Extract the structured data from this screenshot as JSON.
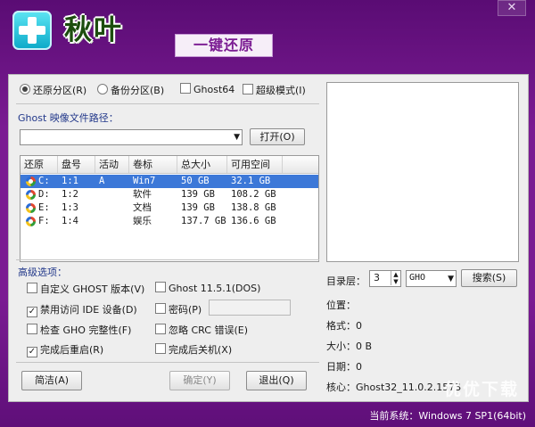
{
  "header": {
    "app_title": "秋叶",
    "tagline": "一键还原",
    "close_glyph": "✕"
  },
  "mode": {
    "restore_label": "还原分区(R)",
    "backup_label": "备份分区(B)",
    "ghost64_label": "Ghost64",
    "super_mode_label": "超级模式(I)",
    "selected": "restore"
  },
  "ghost_path": {
    "label": "Ghost 映像文件路径：",
    "value": "",
    "open_button": "打开(O)"
  },
  "table": {
    "columns": [
      "还原",
      "盘号",
      "活动",
      "卷标",
      "总大小",
      "可用空间"
    ],
    "rows": [
      {
        "drive": "C:",
        "num": "1:1",
        "active": "A",
        "label": "Win7",
        "total": "50 GB",
        "free": "32.1 GB",
        "selected": true
      },
      {
        "drive": "D:",
        "num": "1:2",
        "active": "",
        "label": "软件",
        "total": "139 GB",
        "free": "108.2 GB",
        "selected": false
      },
      {
        "drive": "E:",
        "num": "1:3",
        "active": "",
        "label": "文档",
        "total": "139 GB",
        "free": "138.8 GB",
        "selected": false
      },
      {
        "drive": "F:",
        "num": "1:4",
        "active": "",
        "label": "娱乐",
        "total": "137.7 GB",
        "free": "136.6 GB",
        "selected": false
      }
    ]
  },
  "advanced": {
    "title": "高级选项：",
    "custom_ghost": {
      "label": "自定义 GHOST 版本(V)",
      "checked": false
    },
    "ghost_version": {
      "label": "Ghost 11.5.1(DOS)",
      "checked": false
    },
    "ide_access": {
      "label": "禁用访问 IDE 设备(D)",
      "checked": true
    },
    "password": {
      "label": "密码(P)",
      "checked": false,
      "value": ""
    },
    "check_gho": {
      "label": "检查 GHO 完整性(F)",
      "checked": false
    },
    "ignore_crc": {
      "label": "忽略 CRC 错误(E)",
      "checked": false
    },
    "reboot_after": {
      "label": "完成后重启(R)",
      "checked": true
    },
    "shutdown_after": {
      "label": "完成后关机(X)",
      "checked": false
    }
  },
  "buttons": {
    "about": "简洁(A)",
    "ok": "确定(Y)",
    "exit": "退出(Q)"
  },
  "search": {
    "depth_label": "目录层：",
    "depth_value": "3",
    "type_value": "GHO",
    "search_button": "搜索(S)"
  },
  "file_info": {
    "location": "位置：",
    "format": "格式：0",
    "size": "大小：0 B",
    "date": "日期：0",
    "core": "核心：Ghost32_11.0.2.1573"
  },
  "watermark": "优优下载",
  "status": {
    "system": "当前系统：Windows 7 SP1(64bit)"
  },
  "colors": {
    "window_bg": "#7a1b92",
    "panel_bg": "#eeeeee",
    "selection": "#3c78d8",
    "label_blue": "#22388a"
  }
}
